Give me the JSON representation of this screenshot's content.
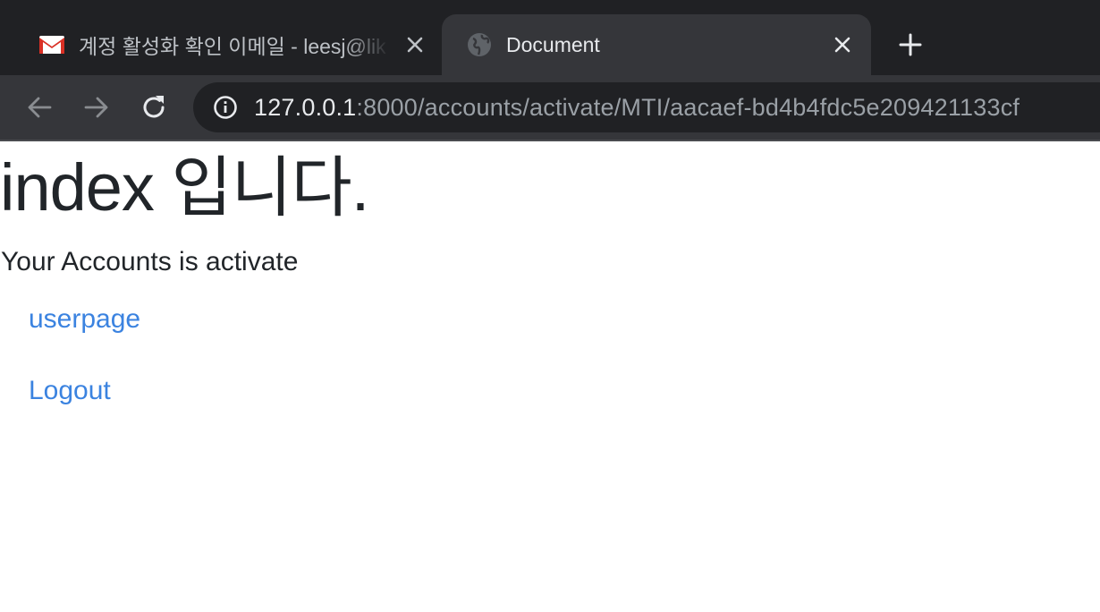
{
  "browser": {
    "tabs": [
      {
        "title": "계정 활성화 확인 이메일 - leesj@lik",
        "favicon": "gmail-icon",
        "active": false
      },
      {
        "title": "Document",
        "favicon": "globe-icon",
        "active": true
      }
    ],
    "address_bar": {
      "host": "127.0.0.1",
      "path": ":8000/accounts/activate/MTI/aacaef-bd4b4fdc5e209421133cf"
    },
    "colors": {
      "tabstrip_bg": "#202124",
      "active_tab_bg": "#35363a",
      "omnibox_bg": "#202124"
    }
  },
  "page": {
    "heading": "index 입니다.",
    "status_message": "Your Accounts is activate",
    "links": [
      {
        "label": "userpage"
      },
      {
        "label": "Logout"
      }
    ],
    "colors": {
      "text": "#212529",
      "link": "#3b83e0"
    }
  }
}
